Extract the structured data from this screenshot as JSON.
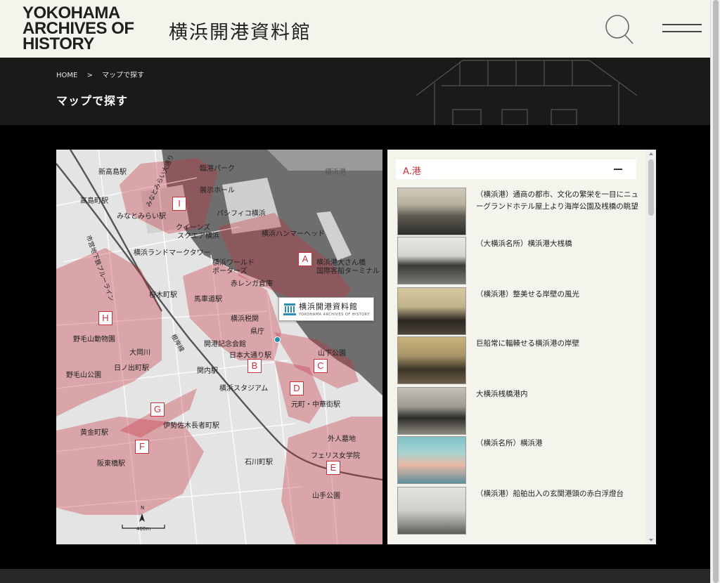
{
  "header": {
    "logo_en_lines": [
      "YOKOHAMA",
      "ARCHIVES OF",
      "HISTORY"
    ],
    "logo_ja": "横浜開港資料館",
    "search_icon": "search-icon",
    "menu_icon": "hamburger-menu-icon"
  },
  "breadcrumb": {
    "home": "HOME",
    "separator": ">",
    "current": "マップで探す"
  },
  "page_title": "マップで探す",
  "map": {
    "places": {
      "shin_takashima": "新高島駅",
      "rinko_park": "臨港パーク",
      "yokohama_port": "横浜港",
      "tenji_hall": "展示ホール",
      "takashimacho": "高島町駅",
      "minatomirai_dori": "みなとみらい大通り",
      "minatomirai_st": "みなとみらい駅",
      "pacifico": "パシフィコ横浜",
      "queens_1": "クイーンズ",
      "queens_2": "スクエア横浜",
      "hammerhead": "横浜ハンマーヘッド",
      "landmark": "横浜ランドマークタワー",
      "subway_line": "市営地下鉄ブルーライン",
      "world_porters_1": "横浜ワールド",
      "world_porters_2": "ポーターズ",
      "osanbashi": "横浜港大さん橋",
      "terminal": "国際客船ターミナル",
      "red_brick": "赤レンガ倉庫",
      "sakuragicho": "桜木町駅",
      "bashamichi": "馬車道駅",
      "zeikan": "横浜税関",
      "kencho": "県庁",
      "nogeyama_zoo": "野毛山動物園",
      "kaiko_kinen": "開港記念会館",
      "nihon_odori": "日本大通り駅",
      "yamashita_park": "山下公園",
      "ooka_river": "大岡川",
      "hinodecho": "日ノ出町駅",
      "kannai": "関内駅",
      "nogeyama_park": "野毛山公園",
      "stadium": "横浜スタジアム",
      "chinatown": "元町・中華街駅",
      "negishi_line": "根岸線",
      "isezakicho": "伊勢佐木長者町駅",
      "koganecho": "黄金町駅",
      "gaijin_bochi": "外人墓地",
      "ferris": "フェリス女学院",
      "ishikawacho": "石川町駅",
      "hanko_bashi": "阪東橋駅",
      "yamate_park": "山手公園"
    },
    "areas": [
      "A",
      "B",
      "C",
      "D",
      "E",
      "F",
      "G",
      "H",
      "I"
    ],
    "museum_tag_ja": "横浜開港資料館",
    "museum_tag_en": "YOKOHAMA ARCHIVES OF HISTORY",
    "scale_label": "400m",
    "north_label": "N",
    "area_color": "#c8323c"
  },
  "list": {
    "heading": "A.港",
    "items": [
      {
        "caption": "（横浜港）通商の都市、文化の繁栄を一目にニューグランドホテル屋上より海岸公園及桟橋の眺望"
      },
      {
        "caption": "（大横浜名所）横浜港大桟橋"
      },
      {
        "caption": "（横浜港）整美せる岸壁の風光"
      },
      {
        "caption": "巨船常に輻輳せる横浜港の岸壁"
      },
      {
        "caption": "大横浜桟橋港内"
      },
      {
        "caption": "（横浜名所）横浜港"
      },
      {
        "caption": "（横浜港）船舶出入の玄関港頭の赤白浮燈台"
      }
    ]
  }
}
